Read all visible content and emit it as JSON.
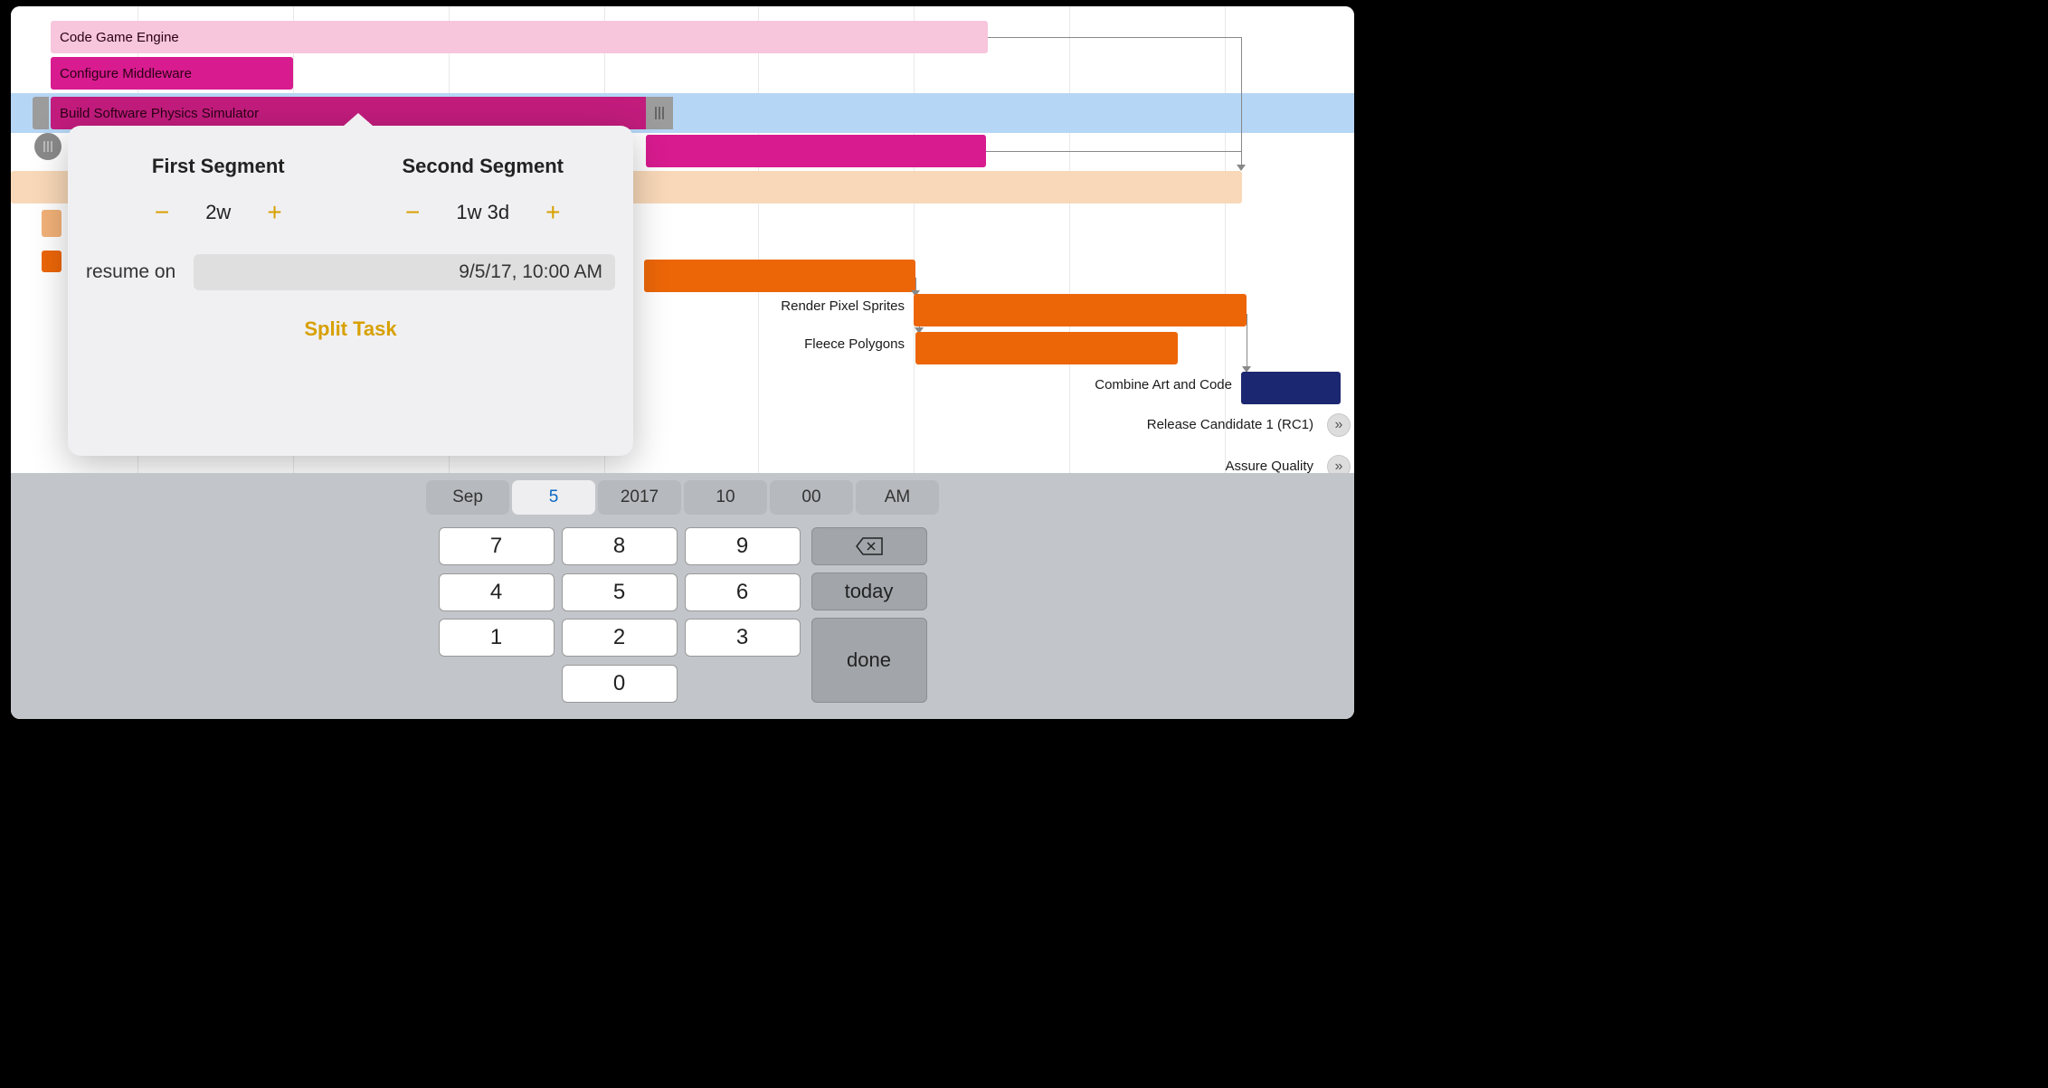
{
  "gantt": {
    "tasks": {
      "code_engine": "Code Game Engine",
      "middleware": "Configure Middleware",
      "physics": "Build Software Physics Simulator",
      "render_sprites": "Render Pixel Sprites",
      "fleece_polygons": "Fleece Polygons",
      "combine": "Combine Art and Code",
      "rc1": "Release Candidate 1 (RC1)",
      "assure_quality": "Assure Quality"
    }
  },
  "popover": {
    "first_segment_label": "First Segment",
    "second_segment_label": "Second Segment",
    "first_value": "2w",
    "second_value": "1w 3d",
    "resume_label": "resume on",
    "resume_value": "9/5/17, 10:00 AM",
    "split_button": "Split Task"
  },
  "picker": {
    "month": "Sep",
    "day": "5",
    "year": "2017",
    "hour": "10",
    "minute": "00",
    "ampm": "AM"
  },
  "keypad": {
    "keys": [
      "7",
      "8",
      "9",
      "4",
      "5",
      "6",
      "1",
      "2",
      "3",
      "0"
    ],
    "today": "today",
    "done": "done"
  }
}
